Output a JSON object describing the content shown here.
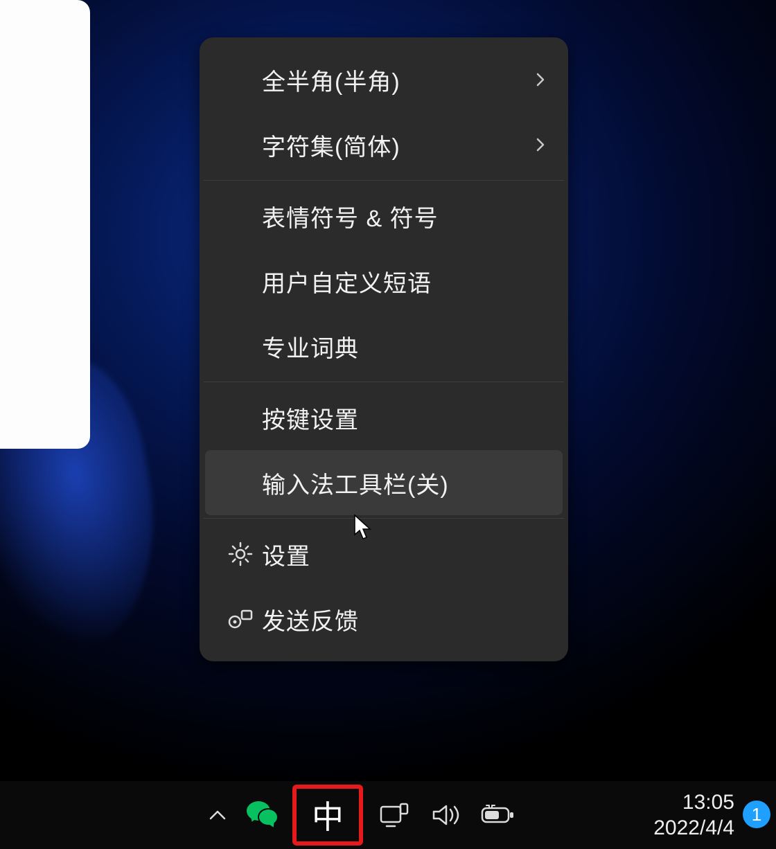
{
  "menu": {
    "items": [
      {
        "label": "全半角(半角)",
        "has_submenu": true,
        "separator_after": false
      },
      {
        "label": "字符集(简体)",
        "has_submenu": true,
        "separator_after": true
      },
      {
        "label": "表情符号 & 符号",
        "has_submenu": false,
        "separator_after": false
      },
      {
        "label": "用户自定义短语",
        "has_submenu": false,
        "separator_after": false
      },
      {
        "label": "专业词典",
        "has_submenu": false,
        "separator_after": true
      },
      {
        "label": "按键设置",
        "has_submenu": false,
        "separator_after": false
      },
      {
        "label": "输入法工具栏(关)",
        "has_submenu": false,
        "separator_after": true,
        "hovered": true
      },
      {
        "label": "设置",
        "has_submenu": false,
        "separator_after": false,
        "icon": "gear"
      },
      {
        "label": "发送反馈",
        "has_submenu": false,
        "separator_after": false,
        "icon": "feedback"
      }
    ]
  },
  "taskbar": {
    "ime_indicator": "中",
    "time": "13:05",
    "date": "2022/4/4",
    "notification_count": "1"
  }
}
